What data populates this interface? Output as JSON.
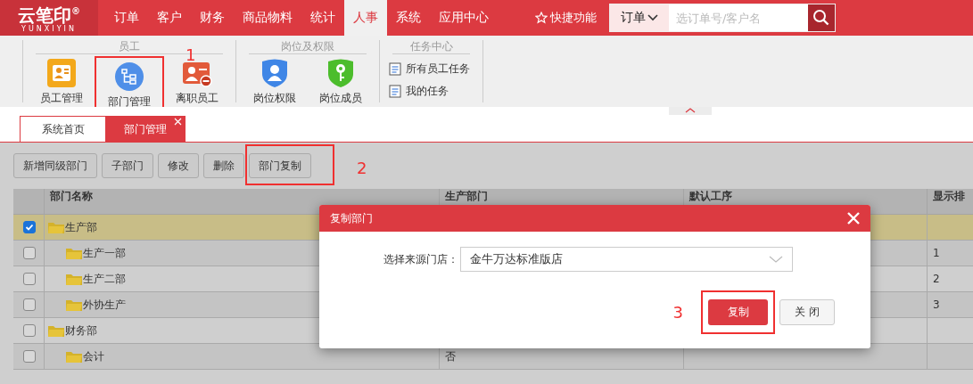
{
  "top_bar": {
    "logo": {
      "text": "云笔印",
      "mark": "®",
      "subtitle": "YUNXIYIN"
    },
    "nav": [
      {
        "label": "订单",
        "selected": false
      },
      {
        "label": "客户",
        "selected": false
      },
      {
        "label": "财务",
        "selected": false
      },
      {
        "label": "商品物料",
        "selected": false
      },
      {
        "label": "统计",
        "selected": false
      },
      {
        "label": "人事",
        "selected": true
      },
      {
        "label": "系统",
        "selected": false
      },
      {
        "label": "应用中心",
        "selected": false
      }
    ],
    "quick_link": "快捷功能",
    "search": {
      "scope": "订单",
      "placeholder": "选订单号/客户名"
    }
  },
  "ribbon": {
    "groups": [
      {
        "title": "员工",
        "kind": "icons",
        "items": [
          {
            "label": "员工管理",
            "kind": "staff"
          },
          {
            "label": "部门管理",
            "kind": "org",
            "annotation": "1"
          },
          {
            "label": "离职员工",
            "kind": "leave"
          }
        ]
      },
      {
        "title": "岗位及权限",
        "kind": "icons",
        "items": [
          {
            "label": "岗位权限",
            "kind": "shield"
          },
          {
            "label": "岗位成员",
            "kind": "key"
          }
        ]
      },
      {
        "title": "任务中心",
        "kind": "list",
        "items": [
          {
            "label": "所有员工任务"
          },
          {
            "label": "我的任务"
          }
        ]
      }
    ]
  },
  "tabs": [
    {
      "label": "系统首页",
      "selected": false,
      "closable": false
    },
    {
      "label": "部门管理",
      "selected": true,
      "closable": true
    }
  ],
  "toolbar": [
    {
      "label": "新增同级部门"
    },
    {
      "label": "子部门"
    },
    {
      "label": "修改"
    },
    {
      "label": "删除"
    },
    {
      "label": "部门复制",
      "annotation": "2"
    }
  ],
  "table": {
    "columns": [
      "部门名称",
      "生产部门",
      "默认工序",
      "显示排"
    ],
    "rows": [
      {
        "name": "生产部",
        "checked": true,
        "selected": true,
        "children": [
          {
            "name": "生产一部",
            "checked": false,
            "selected": false,
            "sort": "1"
          },
          {
            "name": "生产二部",
            "checked": false,
            "selected": false,
            "sort": "2"
          },
          {
            "name": "外协生产",
            "checked": false,
            "selected": false,
            "sort": "3"
          }
        ]
      },
      {
        "name": "财务部",
        "checked": false,
        "selected": false,
        "children": [
          {
            "name": "会计",
            "checked": false,
            "selected": false,
            "production": "否"
          }
        ]
      }
    ]
  },
  "dialog": {
    "title": "复制部门",
    "field": {
      "label": "选择来源门店：",
      "value": "金牛万达标准版店"
    },
    "buttons": [
      {
        "label": "复制",
        "kind": "primary",
        "annotation": "3"
      },
      {
        "label": "关 闭",
        "kind": "secondary"
      }
    ]
  }
}
